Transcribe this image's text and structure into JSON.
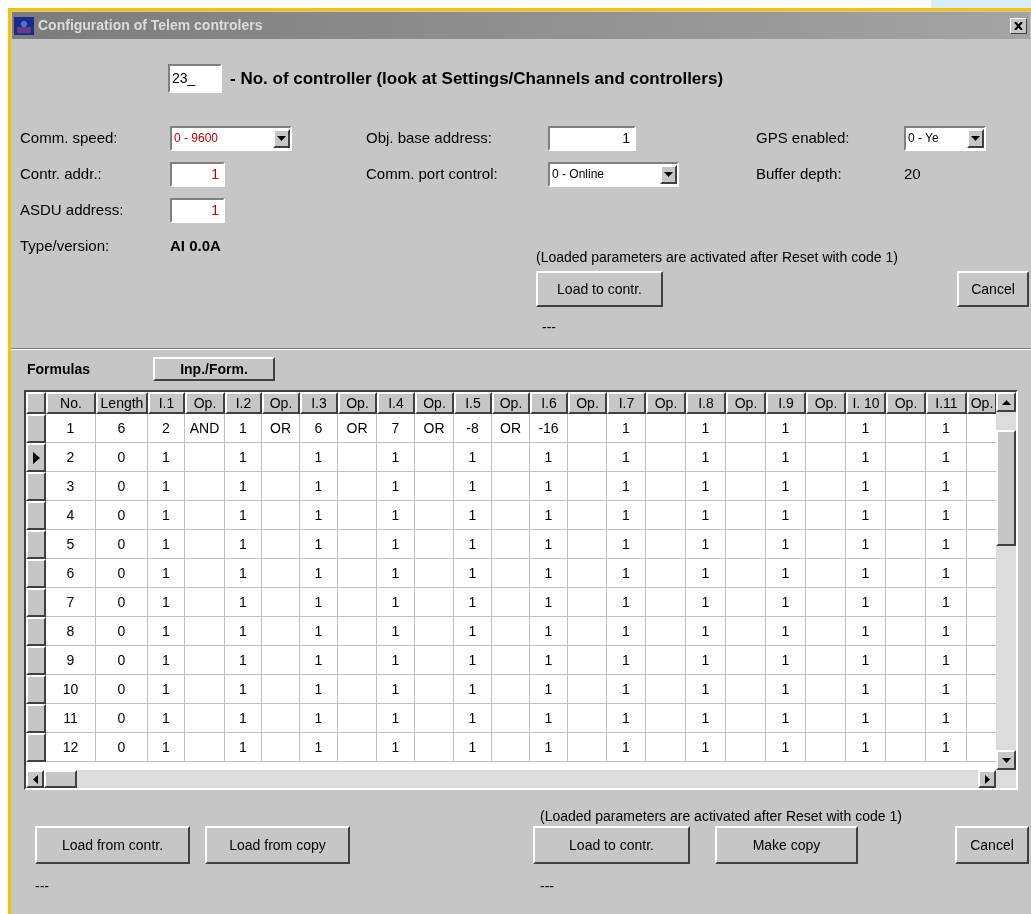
{
  "window": {
    "title": "Configuration of Telem controlers"
  },
  "controller": {
    "value": "23_",
    "label": "- No. of controller (look at Settings/Channels and controllers)"
  },
  "parameter_columns": [
    [
      {
        "label": "Comm. speed:",
        "kind": "dropdown",
        "value": "0 - 9600",
        "color": "#c00000"
      },
      {
        "label": "Contr. addr.:",
        "kind": "input",
        "value": "1",
        "color": "#c00000"
      },
      {
        "label": "ASDU address:",
        "kind": "input",
        "value": "1",
        "color": "#c00000"
      },
      {
        "label": "Type/version:",
        "kind": "version",
        "value": "AI 0.0A"
      }
    ],
    [
      {
        "label": "Obj. base address:",
        "kind": "input",
        "value": "1",
        "color": "#000000"
      },
      {
        "label": "Comm. port control:",
        "kind": "dropdown",
        "value": "0 - Online",
        "color": "#000000"
      }
    ],
    [
      {
        "label": "GPS enabled:",
        "kind": "dropdown",
        "value": "0 - Ye",
        "color": "#000000"
      },
      {
        "label": "Buffer depth:",
        "kind": "readout",
        "value": "20"
      }
    ]
  ],
  "top_actions": {
    "note": "(Loaded parameters are activated after Reset with code 1)",
    "buttons": [
      "Load to contr.",
      "Cancel"
    ],
    "status": "---"
  },
  "formulas": {
    "label": "Formulas",
    "toggle_button": "Inp./Form.",
    "table": {
      "columns": [
        "No.",
        "Length",
        "I.1",
        "Op.",
        "I.2",
        "Op.",
        "I.3",
        "Op.",
        "I.4",
        "Op.",
        "I.5",
        "Op.",
        "I.6",
        "Op.",
        "I.7",
        "Op.",
        "I.8",
        "Op.",
        "I.9",
        "Op.",
        "I. 10",
        "Op.",
        "I.11",
        "Op."
      ],
      "rows": [
        {
          "selected": false,
          "cells": [
            "1",
            "6",
            "2",
            "AND",
            "1",
            "OR",
            "6",
            "OR",
            "7",
            "OR",
            "-8",
            "OR",
            "-16",
            null,
            "1",
            null,
            "1",
            null,
            "1",
            null,
            "1",
            null,
            "1",
            null
          ]
        },
        {
          "selected": true,
          "cells": [
            "2",
            "0",
            "1",
            null,
            "1",
            null,
            "1",
            null,
            "1",
            null,
            "1",
            null,
            "1",
            null,
            "1",
            null,
            "1",
            null,
            "1",
            null,
            "1",
            null,
            "1",
            null
          ]
        },
        {
          "selected": false,
          "cells": [
            "3",
            "0",
            "1",
            null,
            "1",
            null,
            "1",
            null,
            "1",
            null,
            "1",
            null,
            "1",
            null,
            "1",
            null,
            "1",
            null,
            "1",
            null,
            "1",
            null,
            "1",
            null
          ]
        },
        {
          "selected": false,
          "cells": [
            "4",
            "0",
            "1",
            null,
            "1",
            null,
            "1",
            null,
            "1",
            null,
            "1",
            null,
            "1",
            null,
            "1",
            null,
            "1",
            null,
            "1",
            null,
            "1",
            null,
            "1",
            null
          ]
        },
        {
          "selected": false,
          "cells": [
            "5",
            "0",
            "1",
            null,
            "1",
            null,
            "1",
            null,
            "1",
            null,
            "1",
            null,
            "1",
            null,
            "1",
            null,
            "1",
            null,
            "1",
            null,
            "1",
            null,
            "1",
            null
          ]
        },
        {
          "selected": false,
          "cells": [
            "6",
            "0",
            "1",
            null,
            "1",
            null,
            "1",
            null,
            "1",
            null,
            "1",
            null,
            "1",
            null,
            "1",
            null,
            "1",
            null,
            "1",
            null,
            "1",
            null,
            "1",
            null
          ]
        },
        {
          "selected": false,
          "cells": [
            "7",
            "0",
            "1",
            null,
            "1",
            null,
            "1",
            null,
            "1",
            null,
            "1",
            null,
            "1",
            null,
            "1",
            null,
            "1",
            null,
            "1",
            null,
            "1",
            null,
            "1",
            null
          ]
        },
        {
          "selected": false,
          "cells": [
            "8",
            "0",
            "1",
            null,
            "1",
            null,
            "1",
            null,
            "1",
            null,
            "1",
            null,
            "1",
            null,
            "1",
            null,
            "1",
            null,
            "1",
            null,
            "1",
            null,
            "1",
            null
          ]
        },
        {
          "selected": false,
          "cells": [
            "9",
            "0",
            "1",
            null,
            "1",
            null,
            "1",
            null,
            "1",
            null,
            "1",
            null,
            "1",
            null,
            "1",
            null,
            "1",
            null,
            "1",
            null,
            "1",
            null,
            "1",
            null
          ]
        },
        {
          "selected": false,
          "cells": [
            "10",
            "0",
            "1",
            null,
            "1",
            null,
            "1",
            null,
            "1",
            null,
            "1",
            null,
            "1",
            null,
            "1",
            null,
            "1",
            null,
            "1",
            null,
            "1",
            null,
            "1",
            null
          ]
        },
        {
          "selected": false,
          "cells": [
            "11",
            "0",
            "1",
            null,
            "1",
            null,
            "1",
            null,
            "1",
            null,
            "1",
            null,
            "1",
            null,
            "1",
            null,
            "1",
            null,
            "1",
            null,
            "1",
            null,
            "1",
            null
          ]
        },
        {
          "selected": false,
          "cells": [
            "12",
            "0",
            "1",
            null,
            "1",
            null,
            "1",
            null,
            "1",
            null,
            "1",
            null,
            "1",
            null,
            "1",
            null,
            "1",
            null,
            "1",
            null,
            "1",
            null,
            "1",
            null
          ]
        }
      ]
    }
  },
  "bottom_actions": {
    "note": "(Loaded parameters are activated after Reset with code 1)",
    "left_buttons": [
      "Load from contr.",
      "Load from copy"
    ],
    "right_buttons": [
      "Load to contr.",
      "Make copy",
      "Cancel"
    ],
    "left_status": "---",
    "right_status": "---"
  }
}
